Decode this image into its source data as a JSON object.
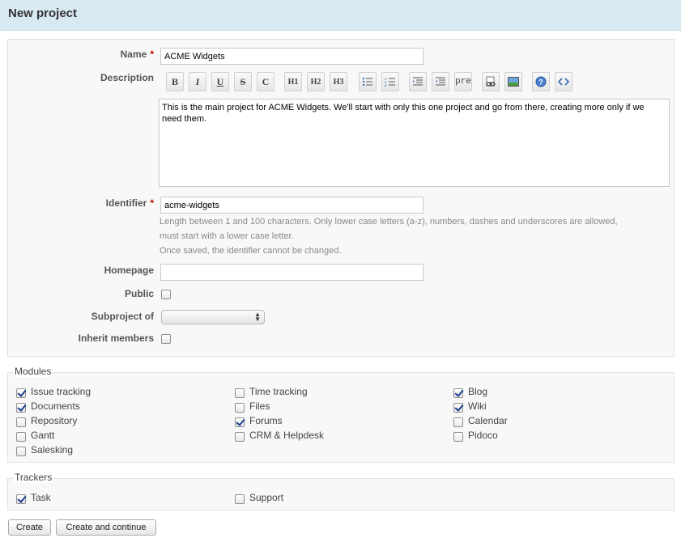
{
  "page": {
    "title": "New project"
  },
  "form": {
    "name_label": "Name",
    "required_mark": "*",
    "name_value": "ACME Widgets",
    "description_label": "Description",
    "description_value": "This is the main project for ACME Widgets. We'll start with only this one project and go from there, creating more only if we need them.",
    "toolbar": [
      {
        "label": "B",
        "icon": "bold-icon"
      },
      {
        "label": "I",
        "icon": "italic-icon"
      },
      {
        "label": "U",
        "icon": "underline-icon"
      },
      {
        "label": "S",
        "icon": "strikethrough-icon"
      },
      {
        "label": "C",
        "icon": "code-icon"
      },
      {
        "label": "H1",
        "icon": "heading-1-icon"
      },
      {
        "label": "H2",
        "icon": "heading-2-icon"
      },
      {
        "label": "H3",
        "icon": "heading-3-icon"
      },
      {
        "label": "",
        "icon": "unordered-list-icon"
      },
      {
        "label": "",
        "icon": "ordered-list-icon"
      },
      {
        "label": "",
        "icon": "quote-icon"
      },
      {
        "label": "",
        "icon": "unquote-icon"
      },
      {
        "label": "pre",
        "icon": "preformatted-icon"
      },
      {
        "label": "",
        "icon": "link-icon"
      },
      {
        "label": "",
        "icon": "image-icon"
      },
      {
        "label": "",
        "icon": "help-icon"
      },
      {
        "label": "",
        "icon": "source-code-icon"
      }
    ],
    "identifier_label": "Identifier",
    "identifier_value": "acme-widgets",
    "identifier_hint_1": "Length between 1 and 100 characters. Only lower case letters (a-z), numbers, dashes and underscores are allowed,",
    "identifier_hint_2": "must start with a lower case letter.",
    "identifier_hint_3": "Once saved, the identifier cannot be changed.",
    "homepage_label": "Homepage",
    "homepage_value": "",
    "public_label": "Public",
    "public_checked": false,
    "subproject_label": "Subproject of",
    "subproject_value": "",
    "inherit_label": "Inherit members",
    "inherit_checked": false
  },
  "modules": {
    "legend": "Modules",
    "items": [
      {
        "label": "Issue tracking",
        "checked": true
      },
      {
        "label": "Documents",
        "checked": true
      },
      {
        "label": "Repository",
        "checked": false
      },
      {
        "label": "Gantt",
        "checked": false
      },
      {
        "label": "Salesking",
        "checked": false
      },
      {
        "label": "Time tracking",
        "checked": false
      },
      {
        "label": "Files",
        "checked": false
      },
      {
        "label": "Forums",
        "checked": true
      },
      {
        "label": "CRM & Helpdesk",
        "checked": false
      },
      {
        "label": "Blog",
        "checked": true
      },
      {
        "label": "Wiki",
        "checked": true
      },
      {
        "label": "Calendar",
        "checked": false
      },
      {
        "label": "Pidoco",
        "checked": false
      }
    ]
  },
  "trackers": {
    "legend": "Trackers",
    "items": [
      {
        "label": "Task",
        "checked": true
      },
      {
        "label": "Support",
        "checked": false
      }
    ]
  },
  "buttons": {
    "create": "Create",
    "create_continue": "Create and continue"
  }
}
